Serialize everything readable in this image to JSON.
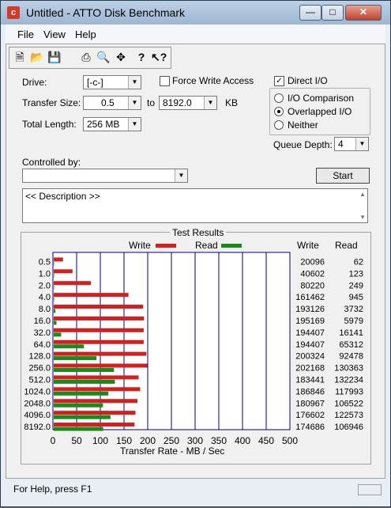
{
  "window": {
    "title": "Untitled - ATTO Disk Benchmark",
    "icon_letter": "c"
  },
  "menu": [
    "File",
    "View",
    "Help"
  ],
  "toolbar_icons": [
    "new-icon",
    "open-icon",
    "save-icon",
    "print-icon",
    "print-preview-icon",
    "move-icon",
    "help-icon",
    "context-help-icon"
  ],
  "form": {
    "drive_label": "Drive:",
    "drive_value": "[-c-]",
    "force_write_label": "Force Write Access",
    "direct_io_label": "Direct I/O",
    "direct_io_checked": true,
    "transfer_size_label": "Transfer Size:",
    "transfer_from": "0.5",
    "transfer_to_label": "to",
    "transfer_to": "8192.0",
    "transfer_unit": "KB",
    "total_length_label": "Total Length:",
    "total_length": "256 MB",
    "io_comparison_label": "I/O Comparison",
    "overlapped_io_label": "Overlapped I/O",
    "neither_label": "Neither",
    "queue_depth_label": "Queue Depth:",
    "queue_depth": "4",
    "controlled_by_label": "Controlled by:",
    "controlled_by_value": "",
    "start_label": "Start",
    "description": "<< Description >>"
  },
  "results": {
    "title": "Test Results",
    "legend_write": "Write",
    "legend_read": "Read",
    "col_write": "Write",
    "col_read": "Read",
    "xlabel": "Transfer Rate - MB / Sec",
    "write_color": "#d41f1f",
    "read_color": "#1a8a1a"
  },
  "chart_data": {
    "type": "bar",
    "orientation": "horizontal",
    "categories": [
      "0.5",
      "1.0",
      "2.0",
      "4.0",
      "8.0",
      "16.0",
      "32.0",
      "64.0",
      "128.0",
      "256.0",
      "512.0",
      "1024.0",
      "2048.0",
      "4096.0",
      "8192.0"
    ],
    "series": [
      {
        "name": "Write",
        "values_kb": [
          20096,
          40602,
          80220,
          161462,
          193126,
          195169,
          194407,
          194407,
          200324,
          202168,
          183441,
          186846,
          180967,
          176602,
          174686
        ]
      },
      {
        "name": "Read",
        "values_kb": [
          62,
          123,
          249,
          945,
          3732,
          5979,
          16141,
          65312,
          92478,
          130363,
          132234,
          117993,
          106522,
          122573,
          106946
        ]
      }
    ],
    "xlim": [
      0,
      500
    ],
    "xticks": [
      0,
      50,
      100,
      150,
      200,
      250,
      300,
      350,
      400,
      450,
      500
    ],
    "xlabel": "Transfer Rate - MB / Sec"
  },
  "status": {
    "text": "For Help, press F1"
  }
}
